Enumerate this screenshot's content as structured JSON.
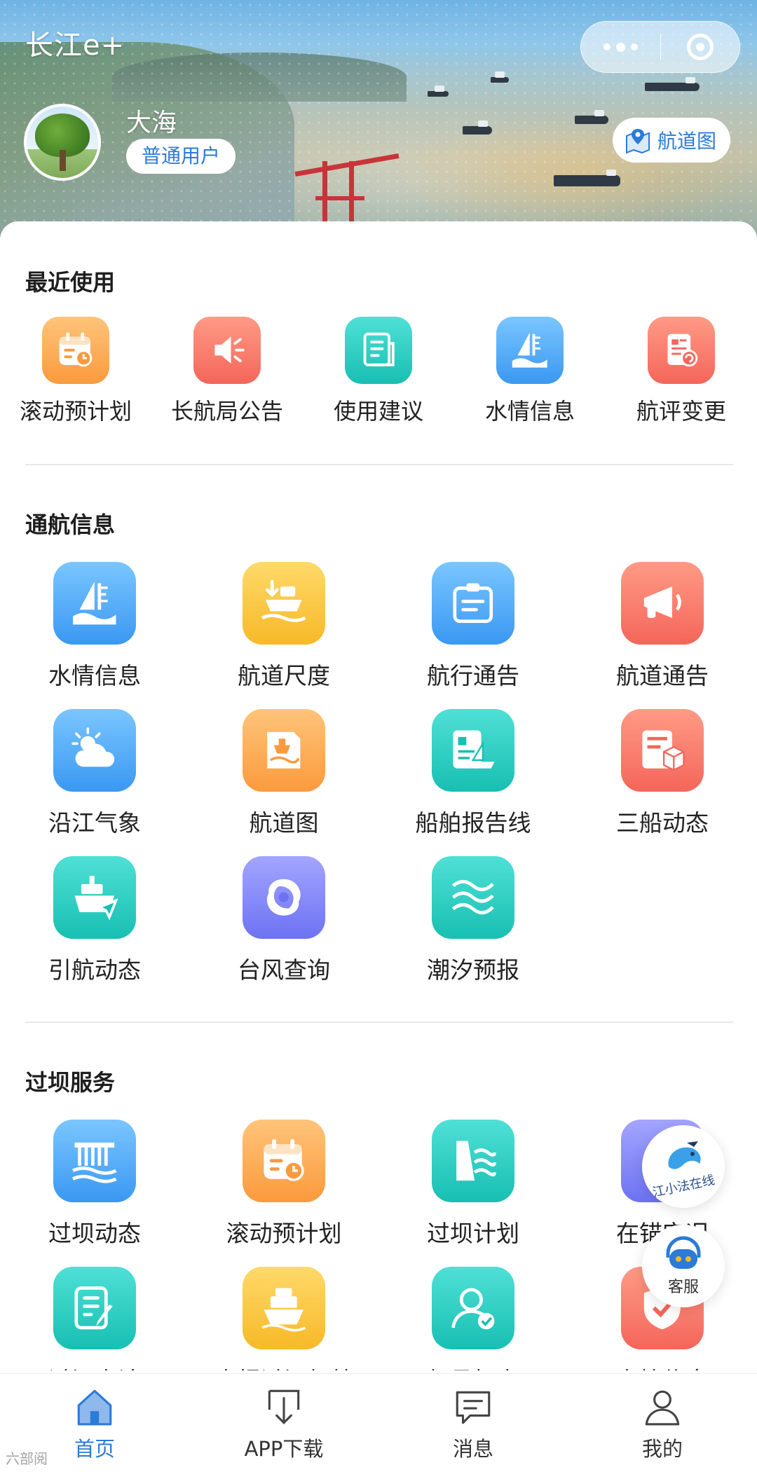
{
  "header": {
    "app_title": "长江e+",
    "user_name": "大海",
    "user_type": "普通用户",
    "map_button": "航道图"
  },
  "sections": {
    "recent": {
      "title": "最近使用",
      "items": [
        {
          "label": "滚动预计划",
          "icon": "calendar-icon",
          "color": "#fb9a3d"
        },
        {
          "label": "长航局公告",
          "icon": "speaker-icon",
          "color": "#f4665a"
        },
        {
          "label": "使用建议",
          "icon": "document-icon",
          "color": "#18bfb2"
        },
        {
          "label": "水情信息",
          "icon": "water-gauge-icon",
          "color": "#3a98f2"
        },
        {
          "label": "航评变更",
          "icon": "form-change-icon",
          "color": "#f4665a"
        }
      ]
    },
    "navigation": {
      "title": "通航信息",
      "items": [
        {
          "label": "水情信息",
          "icon": "water-gauge-icon",
          "color": "#3a98f2"
        },
        {
          "label": "航道尺度",
          "icon": "ship-depth-icon",
          "color": "#f7b928"
        },
        {
          "label": "航行通告",
          "icon": "notice-board-icon",
          "color": "#3a98f2"
        },
        {
          "label": "航道通告",
          "icon": "megaphone-icon",
          "color": "#f4665a"
        },
        {
          "label": "沿江气象",
          "icon": "weather-icon",
          "color": "#3a98f2"
        },
        {
          "label": "航道图",
          "icon": "chart-map-icon",
          "color": "#fb9a3d"
        },
        {
          "label": "船舶报告线",
          "icon": "report-line-icon",
          "color": "#18bfb2"
        },
        {
          "label": "三船动态",
          "icon": "cargo-box-icon",
          "color": "#f4665a"
        },
        {
          "label": "引航动态",
          "icon": "pilot-ship-icon",
          "color": "#18bfb2"
        },
        {
          "label": "台风查询",
          "icon": "typhoon-icon",
          "color": "#6d72f3"
        },
        {
          "label": "潮汐预报",
          "icon": "tide-icon",
          "color": "#18bfb2"
        }
      ]
    },
    "dam": {
      "title": "过坝服务",
      "items": [
        {
          "label": "过坝动态",
          "icon": "dam-gate-icon",
          "color": "#3a98f2"
        },
        {
          "label": "滚动预计划",
          "icon": "calendar-icon",
          "color": "#fb9a3d"
        },
        {
          "label": "过坝计划",
          "icon": "dam-plan-icon",
          "color": "#18bfb2"
        },
        {
          "label": "在锚实况",
          "icon": "anchor-icon",
          "color": "#6d72f3"
        },
        {
          "label": "过闸申请",
          "icon": "edit-form-icon",
          "color": "#18bfb2"
        },
        {
          "label": "申报过闸船舶",
          "icon": "ship-declare-icon",
          "color": "#f7b928"
        },
        {
          "label": "船员打卡",
          "icon": "crew-checkin-icon",
          "color": "#18bfb2"
        },
        {
          "label": "安检信息",
          "icon": "shield-check-icon",
          "color": "#f4665a"
        }
      ]
    }
  },
  "floating": {
    "assistant_label": "江小法在线",
    "service_label": "客服"
  },
  "tabbar": {
    "items": [
      {
        "label": "首页",
        "icon": "home-icon",
        "active": true
      },
      {
        "label": "APP下载",
        "icon": "download-icon",
        "active": false
      },
      {
        "label": "消息",
        "icon": "message-icon",
        "active": false
      },
      {
        "label": "我的",
        "icon": "profile-icon",
        "active": false
      }
    ],
    "active_color": "#2b7bd8"
  },
  "watermark": "六部阅"
}
